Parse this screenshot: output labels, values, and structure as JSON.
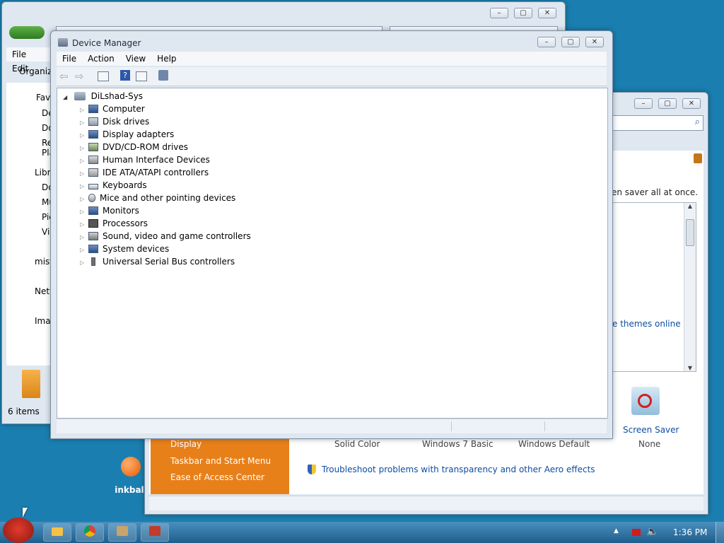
{
  "explorer": {
    "menu": [
      "File",
      "Edit"
    ],
    "organize": "Organize",
    "nav": [
      "Favorites",
      "Desktop",
      "Downloads",
      "Recent Places",
      "Libraries",
      "Documents",
      "Music",
      "Pictures",
      "Videos",
      "mist",
      "Network",
      "Imageshack"
    ],
    "status": "6 items"
  },
  "devmgr": {
    "title": "Device Manager",
    "menu": [
      "File",
      "Action",
      "View",
      "Help"
    ],
    "root": "DiLshad-Sys",
    "items": [
      "Computer",
      "Disk drives",
      "Display adapters",
      "DVD/CD-ROM drives",
      "Human Interface Devices",
      "IDE ATA/ATAPI controllers",
      "Keyboards",
      "Mice and other pointing devices",
      "Monitors",
      "Processors",
      "Sound, video and game controllers",
      "System devices",
      "Universal Serial Bus controllers"
    ]
  },
  "personalize": {
    "partial_text": "en saver all at once.",
    "themes_link": "e themes online",
    "screen_saver_label": "Screen Saver",
    "screen_saver_value": "None",
    "themes": [
      "Solid Color",
      "Windows 7 Basic",
      "Windows Default"
    ],
    "see_also": [
      "Display",
      "Taskbar and Start Menu",
      "Ease of Access Center"
    ],
    "troubleshoot": "Troubleshoot problems with transparency and other Aero effects"
  },
  "desktop": {
    "inkball": "inkball"
  },
  "tray": {
    "time": "1:36 PM"
  },
  "colors": {
    "desktop": "#1a7fb0",
    "sidebar_orange": "#e8801a",
    "link": "#0d4da1"
  }
}
